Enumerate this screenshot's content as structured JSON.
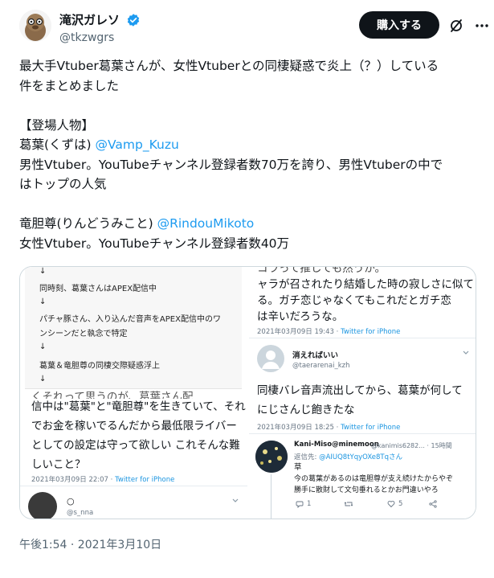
{
  "author": {
    "display_name": "滝沢ガレソ",
    "handle": "@tkzwgrs"
  },
  "actions": {
    "buy_label": "購入する",
    "grok_icon": "grok-slash-icon",
    "more_icon": "more-dots-icon"
  },
  "tweet": {
    "line1": "最大手Vtuber葛葉さんが、女性Vtuberとの同棲疑惑で炎上（？）している",
    "line2": "件をまとめました",
    "section_header": "【登場人物】",
    "p1_name": "葛葉(くずは) ",
    "p1_mention": "@Vamp_Kuzu",
    "p1_desc_1": "男性Vtuber。YouTubeチャンネル登録者数70万を誇り、男性Vtuberの中で",
    "p1_desc_2": "はトップの人気",
    "p2_name": "竜胆尊(りんどうみこと) ",
    "p2_mention": "@RindouMikoto",
    "p2_desc": "女性Vtuber。YouTubeチャンネル登録者数40万"
  },
  "media_left": {
    "flow": [
      "↓",
      "同時刻、葛葉さんはAPEX配信中",
      "↓",
      "パチャ豚さん、入り込んだ音声をAPEX配信中のワ",
      "ンシーンだと執念で特定",
      "↓",
      "葛葉＆竜胆尊の同棲交際疑惑浮上",
      "↓"
    ],
    "quote_cut": "くそれって思うのが、葛葉さん配",
    "quote_lines": [
      "信中は\"葛葉\"と\"竜胆尊\"を生きていて、それ",
      "でお金を稼いでるんだから最低限ライバー",
      "としての設定は守って欲しい これそんな難",
      "しいこと？"
    ],
    "quote_meta_time": "2021年03月09日 22:07 · ",
    "quote_meta_src": "Twitter for iPhone",
    "next_name": "○",
    "next_handle": "@s_nna"
  },
  "media_right": {
    "top_cut": "コラって推しても然うか。",
    "top_lines": [
      "ャラが召されたり結婚した時の寂しさに似て",
      "る。ガチ恋じゃなくてもこれだとガチ恋",
      "は辛いだろうな。"
    ],
    "top_meta_time": "2021年03月09日 19:43 · ",
    "top_meta_src": "Twitter for iPhone",
    "mid_name": "消えればいい",
    "mid_handle": "@taerarenai_kzh",
    "mid_lines": [
      "同棲バレ音声流出してから、葛葉が何して",
      "にじさんじ飽きたな"
    ],
    "mid_meta_time": "2021年03月09日 18:25 · ",
    "mid_meta_src": "Twitter for iPhone",
    "reply_name": "Kani-Miso@minemoon",
    "reply_handle": "@kanimis6282... · 15時間",
    "reply_to_label": "返信先: ",
    "reply_to_handle": "@AIUQ8tYqyOXe8Tqさん",
    "reply_lines": [
      "草",
      "今の葛葉があるのは竜胆尊が支え続けたからやぞ",
      "勝手に散財して文句垂れるとかお門違いやろ"
    ],
    "reply_count": "1",
    "like_count": "5"
  },
  "footer": {
    "timestamp": "午後1:54 · 2021年3月10日"
  }
}
